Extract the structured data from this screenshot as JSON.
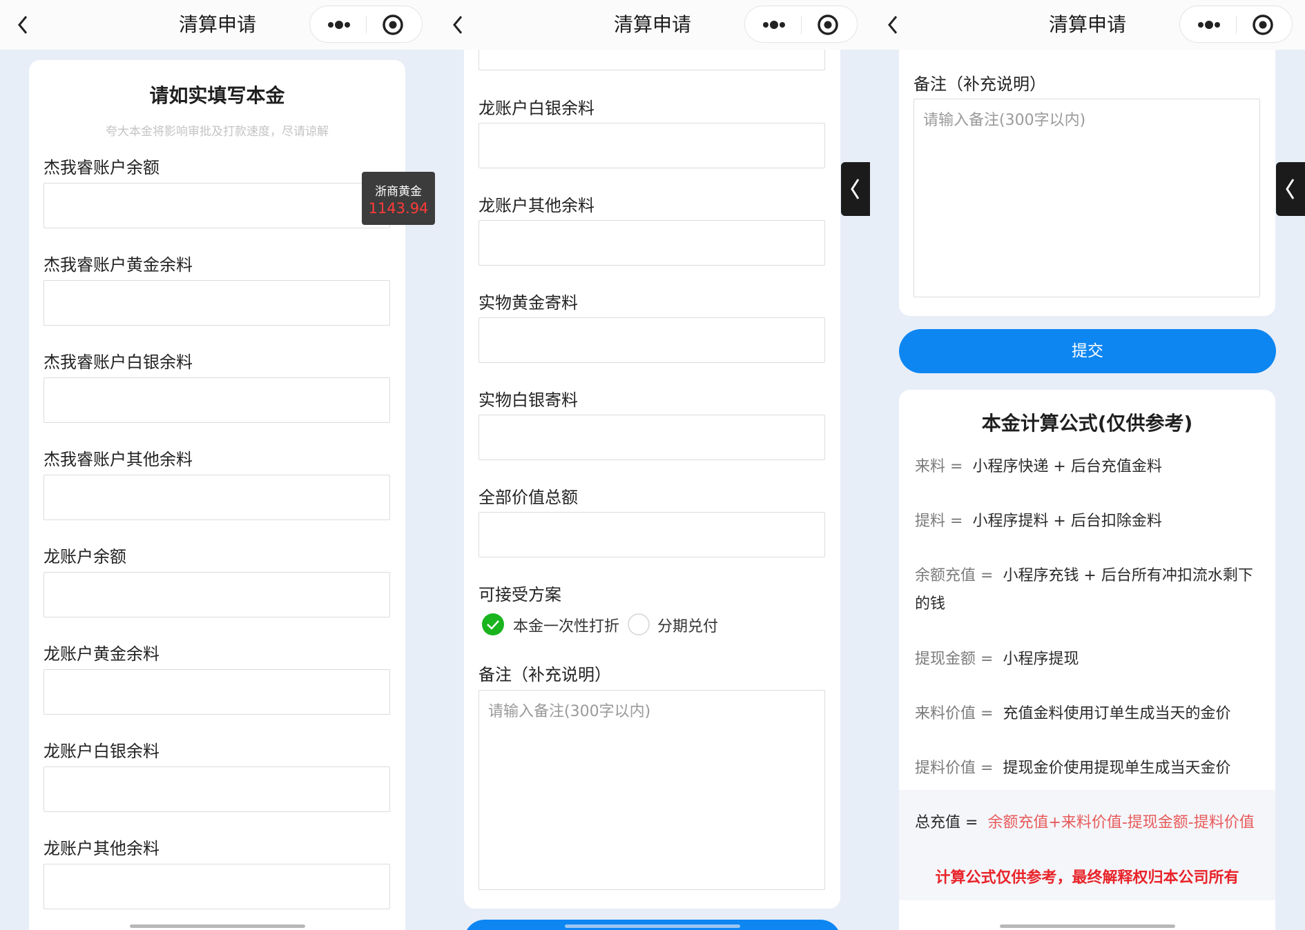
{
  "nav": {
    "title": "清算申请"
  },
  "screen1": {
    "heading": "请如实填写本金",
    "subheading": "夸大本金将影响审批及打款速度，尽请谅解",
    "fields": [
      "杰我睿账户余额",
      "杰我睿账户黄金余料",
      "杰我睿账户白银余料",
      "杰我睿账户其他余料",
      "龙账户余额",
      "龙账户黄金余料",
      "龙账户白银余料",
      "龙账户其他余料"
    ],
    "gold_widget": {
      "name": "浙商黄金",
      "price": "1143.94"
    }
  },
  "screen2": {
    "fields": [
      "龙账户白银余料",
      "龙账户其他余料",
      "实物黄金寄料",
      "实物白银寄料",
      "全部价值总额"
    ],
    "plan_label": "可接受方案",
    "options": [
      {
        "label": "本金一次性打折",
        "selected": true
      },
      {
        "label": "分期兑付",
        "selected": false
      }
    ],
    "remark_label": "备注（补充说明）",
    "remark_placeholder": "请输入备注(300字以内)"
  },
  "screen3": {
    "remark_label": "备注（补充说明）",
    "remark_placeholder": "请输入备注(300字以内)",
    "submit_label": "提交",
    "formula_title": "本金计算公式(仅供参考)",
    "formulas": [
      {
        "key": "来料 =",
        "value": "小程序快递 + 后台充值金料"
      },
      {
        "key": "提料 =",
        "value": "小程序提料 + 后台扣除金料"
      },
      {
        "key": "余额充值 =",
        "value": "小程序充钱 + 后台所有冲扣流水剩下",
        "value2": "的钱"
      },
      {
        "key": "提现金额 =",
        "value": "小程序提现"
      },
      {
        "key": "来料价值 =",
        "value": "充值金料使用订单生成当天的金价"
      },
      {
        "key": "提料价值 =",
        "value": "提现金价使用提现单生成当天金价"
      },
      {
        "key": "总充值 =",
        "value": "余额充值+来料价值-提现金额-提料价值"
      }
    ],
    "disclaimer": "计算公式仅供参考，最终解释权归本公司所有"
  },
  "colors": {
    "page_bg": "#e8eef8",
    "accent": "#0d86f2",
    "check_green": "#19b41e",
    "warn_red": "#e8242a",
    "formula_red": "#e85a5a"
  },
  "icons": [
    "back-chevron-icon",
    "more-dots-icon",
    "close-target-icon",
    "checkmark-icon",
    "chevron-left-icon"
  ]
}
